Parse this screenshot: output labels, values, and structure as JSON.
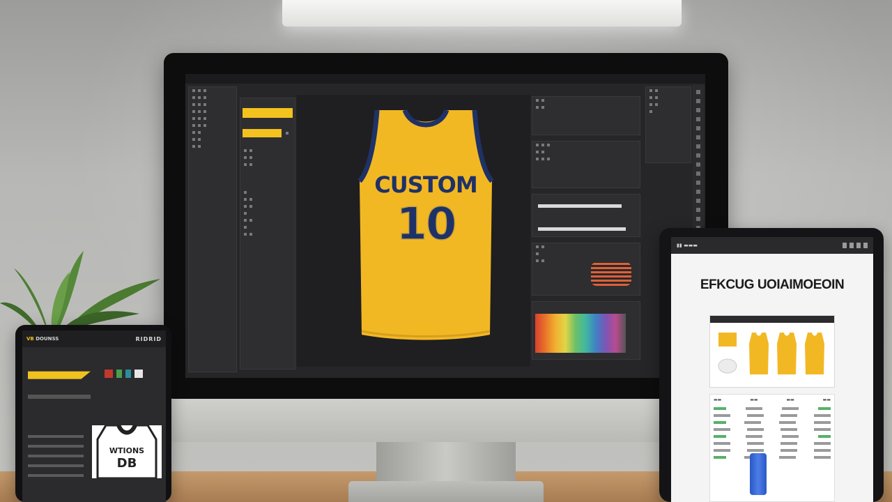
{
  "monitor": {
    "menubar": {
      "items": [
        "",
        "",
        "",
        "",
        "",
        ""
      ]
    },
    "jersey": {
      "word": "CUSTOM",
      "number": "10",
      "body_color": "#f2b824",
      "trim_color": "#1f3267"
    },
    "accent_color": "#f3c21f"
  },
  "tablet": {
    "title": "EFKCUG UOIAIMOEOIN"
  },
  "phone": {
    "brand_prefix": "VB",
    "brand_suffix": "DOUNSS",
    "menu_text": "RIDRID",
    "jersey_word": "WTIONS",
    "jersey_number": "DB"
  },
  "colors": {
    "wall": "#b5b6b3",
    "desk": "#b88a5e",
    "screen_bg": "#262628"
  }
}
